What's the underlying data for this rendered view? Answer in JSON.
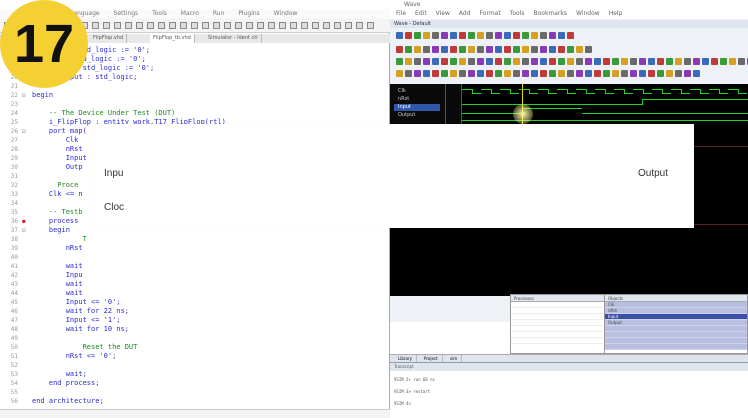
{
  "editor": {
    "tabs": [
      "FlipFlop.vhd",
      "FlipFlop_tb.vhd",
      "Simulator - Ident ctl"
    ],
    "code_lines": [
      {
        "n": "17",
        "text": "      lk : std_logic := '0';",
        "cls": ""
      },
      {
        "n": "18",
        "text": "      t : std_logic := '0';",
        "cls": ""
      },
      {
        "n": "19",
        "text": "      put : std_logic := '0';",
        "cls": ""
      },
      {
        "n": "20",
        "text": "      Output : std_logic;",
        "cls": ""
      },
      {
        "n": "21",
        "text": "",
        "cls": ""
      },
      {
        "n": "22",
        "text": "begin",
        "cls": ""
      },
      {
        "n": "23",
        "text": "",
        "cls": ""
      },
      {
        "n": "24",
        "text": "    -- The Device Under Test (DUT)",
        "cls": "cm"
      },
      {
        "n": "25",
        "text": "    i_FlipFlop : entity work.T17_FlipFlop(rtl)",
        "cls": ""
      },
      {
        "n": "26",
        "text": "    port map(",
        "cls": ""
      },
      {
        "n": "27",
        "text": "        Clk     => Cl",
        "cls": ""
      },
      {
        "n": "28",
        "text": "        nRst    => nR",
        "cls": ""
      },
      {
        "n": "29",
        "text": "        Input",
        "cls": ""
      },
      {
        "n": "30",
        "text": "        Outp",
        "cls": ""
      },
      {
        "n": "31",
        "text": "",
        "cls": ""
      },
      {
        "n": "32",
        "text": "      Proce",
        "cls": "cm"
      },
      {
        "n": "33",
        "text": "    Clk <= n",
        "cls": ""
      },
      {
        "n": "34",
        "text": "",
        "cls": ""
      },
      {
        "n": "35",
        "text": "    -- Testb",
        "cls": "cm"
      },
      {
        "n": "36",
        "text": "    process",
        "cls": ""
      },
      {
        "n": "37",
        "text": "    begin",
        "cls": ""
      },
      {
        "n": "38",
        "text": "            T",
        "cls": "cm"
      },
      {
        "n": "39",
        "text": "        nRst",
        "cls": ""
      },
      {
        "n": "40",
        "text": "",
        "cls": ""
      },
      {
        "n": "41",
        "text": "        wait",
        "cls": ""
      },
      {
        "n": "42",
        "text": "        Inpu",
        "cls": ""
      },
      {
        "n": "43",
        "text": "        wait",
        "cls": ""
      },
      {
        "n": "44",
        "text": "        wait",
        "cls": ""
      },
      {
        "n": "45",
        "text": "        Input <= '0';",
        "cls": ""
      },
      {
        "n": "46",
        "text": "        wait for 22 ns;",
        "cls": ""
      },
      {
        "n": "47",
        "text": "        Input <= '1';",
        "cls": ""
      },
      {
        "n": "48",
        "text": "        wait for 10 ns;",
        "cls": ""
      },
      {
        "n": "49",
        "text": "",
        "cls": ""
      },
      {
        "n": "50",
        "text": "            Reset the DUT",
        "cls": "cm"
      },
      {
        "n": "51",
        "text": "        nRst <= '0';",
        "cls": ""
      },
      {
        "n": "52",
        "text": "",
        "cls": ""
      },
      {
        "n": "53",
        "text": "        wait;",
        "cls": ""
      },
      {
        "n": "54",
        "text": "    end process;",
        "cls": ""
      },
      {
        "n": "55",
        "text": "",
        "cls": ""
      },
      {
        "n": "56",
        "text": "end architecture;",
        "cls": ""
      }
    ]
  },
  "sim": {
    "title": "Wave",
    "menu": [
      "File",
      "Edit",
      "View",
      "Add",
      "Format",
      "Tools",
      "Bookmarks",
      "Window",
      "Help"
    ],
    "wave_bar": "Wave - Default",
    "signal_names": [
      "Clk",
      "nRst",
      "Input",
      "Output"
    ],
    "transcript_title": "Transcript",
    "transcript_lines": [
      "VSIM 2> run 60 ns",
      "VSIM 3> restart",
      "VSIM 4>"
    ],
    "tabs": [
      "Library",
      "Project",
      "sim"
    ],
    "objects_title": "Objects",
    "object_rows": [
      "Clk",
      "nRst",
      "Input",
      "Output"
    ],
    "tasks_title": "Processes"
  },
  "overlay": {
    "labels": {
      "input": "Inpu",
      "clock": "Cloc",
      "output": "Output"
    }
  },
  "badge": {
    "number": "17"
  }
}
